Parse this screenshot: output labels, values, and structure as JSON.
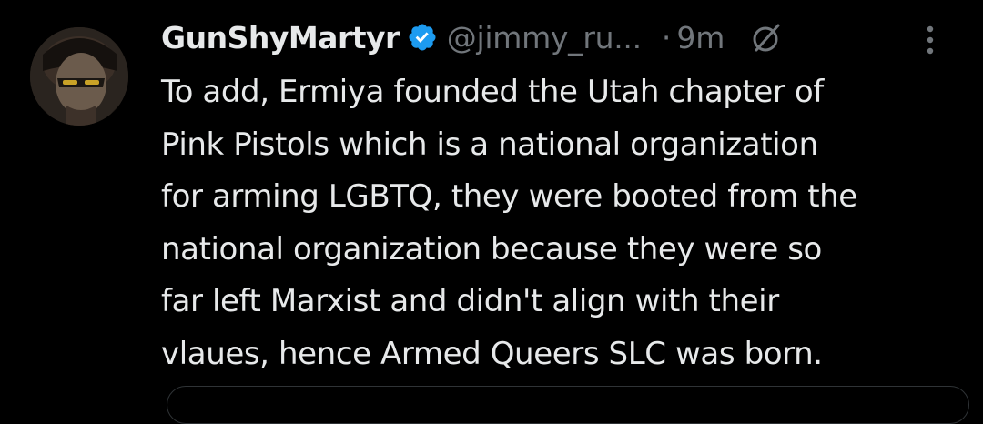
{
  "tweet": {
    "author": {
      "display_name": "GunShyMartyr",
      "handle": "@jimmy_ru...",
      "verified": true
    },
    "separator": "·",
    "time": "9m",
    "text_lines": [
      "To add, Ermiya founded the Utah chapter of",
      "Pink Pistols which is a national organization",
      "for arming LGBTQ, they were booted from the",
      "national organization because they were so",
      "far left Marxist and didn't align with their",
      "vlaues, hence Armed Queers SLC was born."
    ]
  },
  "icons": {
    "verified": "verified-badge-icon",
    "edited": "edit-history-icon",
    "more": "more-options-icon"
  },
  "colors": {
    "background": "#000000",
    "text": "#e7e9ea",
    "secondary": "#71767b",
    "verified_blue": "#1d9bf0",
    "border": "#2f3336"
  }
}
